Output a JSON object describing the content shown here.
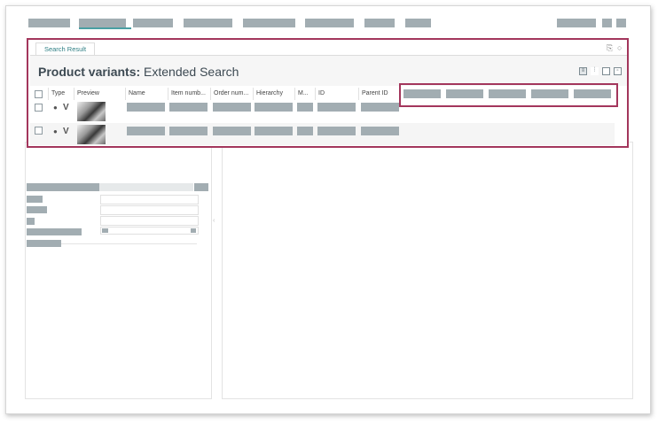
{
  "search_result": {
    "tab_label": "Search Result",
    "title_bold": "Product variants:",
    "title_rest": " Extended Search",
    "icons": [
      "export-icon",
      "refresh-icon",
      "list-view-icon",
      "tree-view-icon",
      "tile-view-icon",
      "settings-view-icon"
    ]
  },
  "table": {
    "columns": [
      "Type",
      "Preview",
      "Name",
      "Item numb...",
      "Order num...",
      "Hierarchy",
      "M...",
      "ID",
      "Parent ID"
    ],
    "rows": [
      {
        "type_label": "V"
      },
      {
        "type_label": "V"
      }
    ]
  }
}
